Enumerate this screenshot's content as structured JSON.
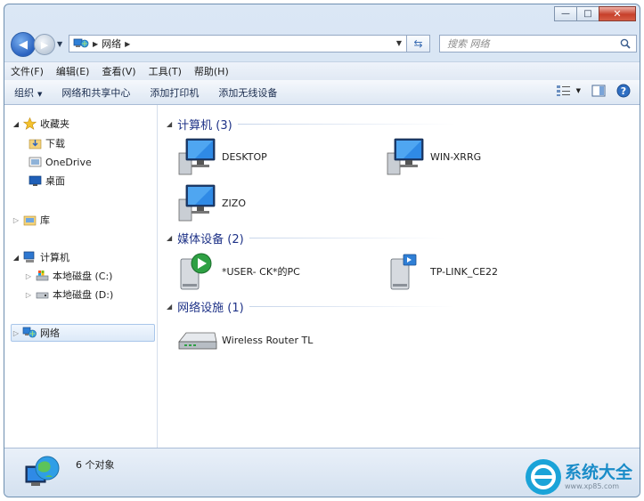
{
  "window": {
    "caption": {
      "minimize": "—",
      "maximize": "□",
      "close": "✕"
    }
  },
  "address": {
    "segments": [
      "网络"
    ]
  },
  "search": {
    "placeholder": "搜索 网络"
  },
  "menu": [
    "文件(F)",
    "编辑(E)",
    "查看(V)",
    "工具(T)",
    "帮助(H)"
  ],
  "commands": {
    "organize": "组织",
    "network_center": "网络和共享中心",
    "add_printer": "添加打印机",
    "add_wireless": "添加无线设备"
  },
  "nav": {
    "favorites": "收藏夹",
    "downloads": "下载",
    "onedrive": "OneDrive",
    "desktop": "桌面",
    "libraries": "库",
    "computer": "计算机",
    "disk_c": "本地磁盘 (C:)",
    "disk_d": "本地磁盘 (D:)",
    "network": "网络"
  },
  "groups": [
    {
      "label": "计算机 (3)",
      "items": [
        "DESKTOP",
        "WIN-XRRG",
        "ZIZO"
      ]
    },
    {
      "label": "媒体设备 (2)",
      "items": [
        "*USER-          CK*的PC",
        "TP-LINK_CE22"
      ]
    },
    {
      "label": "网络设施 (1)",
      "items": [
        "Wireless Router TL"
      ]
    }
  ],
  "status": {
    "count": "6 个对象"
  },
  "brand": {
    "title": "系统大全",
    "url": "www.xp85.com"
  },
  "colors": {
    "accent": "#1e3287",
    "brand": "#1a8cc8"
  }
}
